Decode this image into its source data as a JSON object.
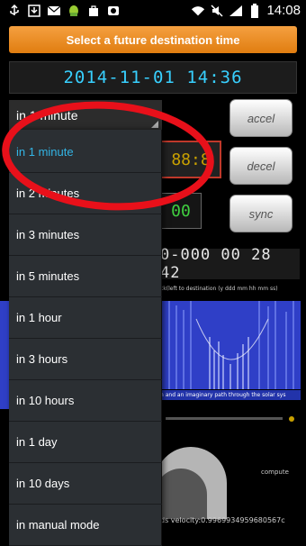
{
  "status_bar": {
    "time": "14:08",
    "left_icons": [
      "usb-icon",
      "download-icon",
      "mail-icon",
      "android-icon",
      "bag-icon",
      "photo-icon"
    ],
    "right_icons": [
      "wifi-icon",
      "mute-icon",
      "signal-icon",
      "battery-icon"
    ]
  },
  "header": {
    "destination_button_label": "Select a future destination time",
    "destination_datetime": "2014-11-01  14:36"
  },
  "controls": {
    "accel_label": "accel",
    "decel_label": "decel",
    "sync_label": "sync"
  },
  "background": {
    "seg_display_1": "88:8",
    "seg_display_2": "00",
    "countdown": "0-000 00 28 42",
    "countdown_caption": "ck(left to destination (y ddd mm hh mm ss)",
    "spectrum_caption": "n and an imaginary path through the solar sys",
    "compute_label": "compute",
    "velocity_text": "ds velocity:0.9969934959680567c"
  },
  "spinner": {
    "selected_value": "in 1 minute"
  },
  "dropdown": {
    "options": [
      {
        "label": "in 1 minute",
        "selected": true
      },
      {
        "label": "in 2 minutes",
        "selected": false
      },
      {
        "label": "in 3 minutes",
        "selected": false
      },
      {
        "label": "in 5 minutes",
        "selected": false
      },
      {
        "label": "in 1 hour",
        "selected": false
      },
      {
        "label": "in 3 hours",
        "selected": false
      },
      {
        "label": "in 10 hours",
        "selected": false
      },
      {
        "label": "in 1 day",
        "selected": false
      },
      {
        "label": "in 10 days",
        "selected": false
      },
      {
        "label": "in manual mode",
        "selected": false
      }
    ]
  },
  "colors": {
    "accent_orange": "#e88a1f",
    "selected_blue": "#33b5e5",
    "annotation_red": "#e8101a",
    "spectrum_blue": "#2f3fc7"
  }
}
